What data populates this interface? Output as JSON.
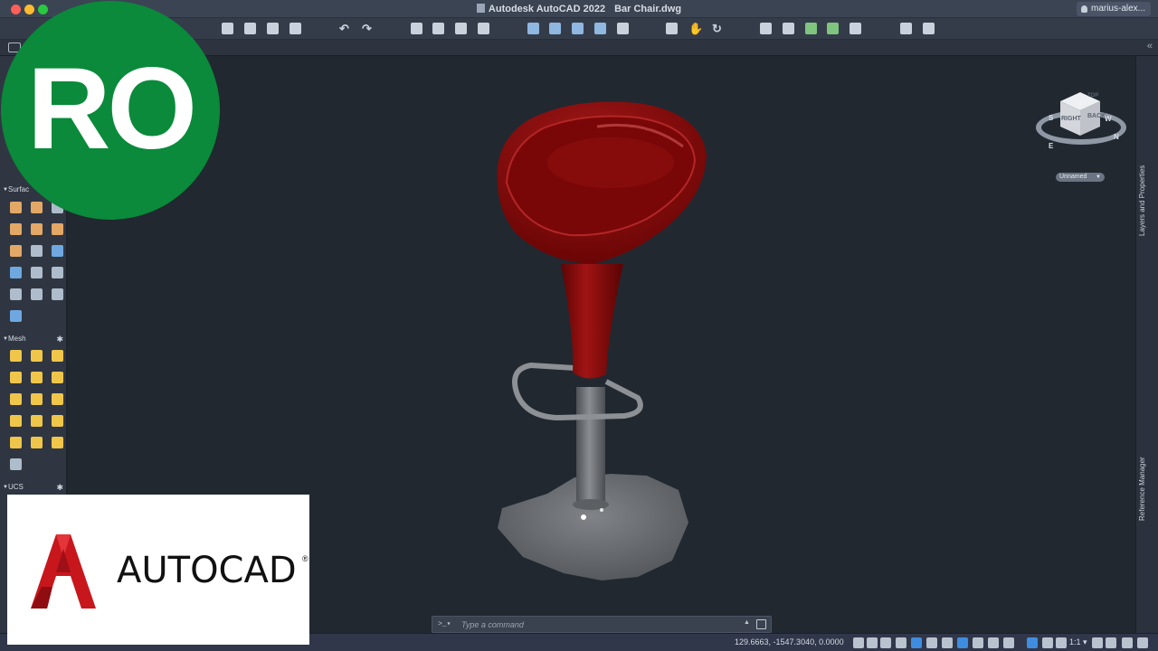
{
  "window": {
    "app_title": "Autodesk AutoCAD 2022",
    "document": "Bar Chair.dwg",
    "user": "marius-alex..."
  },
  "palette": {
    "sections": [
      {
        "label": "Surfac",
        "icon": "triangle-down-icon"
      },
      {
        "label": "Mesh",
        "icon": "triangle-down-icon"
      },
      {
        "label": "UCS",
        "icon": "triangle-down-icon"
      }
    ]
  },
  "viewcube": {
    "top_label": "TOP",
    "right_label": "RIGHT",
    "back_label": "BACK",
    "compass": {
      "north": "N",
      "south": "S",
      "east": "E",
      "west": "W"
    },
    "ucs_menu": "Unnamed"
  },
  "side_palettes": {
    "layers": "Layers and Properties",
    "reference": "Reference Manager"
  },
  "command_line": {
    "prompt": ">_▾",
    "placeholder": "Type a command"
  },
  "status_bar": {
    "coordinates": "129.6663,   -1547.3040, 0.0000",
    "scale": "1:1 ▾"
  },
  "overlay": {
    "badge_text": "RO",
    "logo_word": "AUTOCAD",
    "logo_mark": "®"
  },
  "colors": {
    "seat": "#8b0a0a",
    "metal": "#6e7276",
    "badge": "#0a8a3a",
    "logo_red": "#c8161d"
  }
}
